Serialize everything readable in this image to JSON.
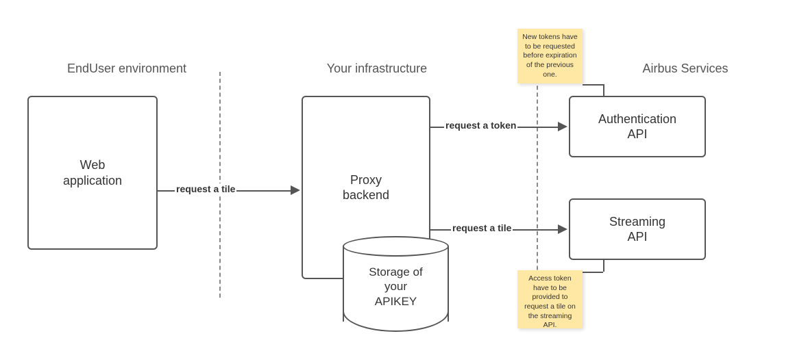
{
  "sections": {
    "enduser": "EndUser environment",
    "infra": "Your infrastructure",
    "airbus": "Airbus Services"
  },
  "nodes": {
    "webapp": "Web\napplication",
    "proxy": "Proxy\nbackend",
    "cylinder": "Storage of\nyour\nAPIKEY",
    "auth": "Authentication\nAPI",
    "stream": "Streaming\nAPI"
  },
  "edges": {
    "tile1": "request a tile",
    "token": "request a token",
    "tile2": "request a tile"
  },
  "notes": {
    "top": "New tokens have to be requested before expiration of the previous one.",
    "bottom": "Access token have to be provided to request a tile on the streaming API."
  }
}
